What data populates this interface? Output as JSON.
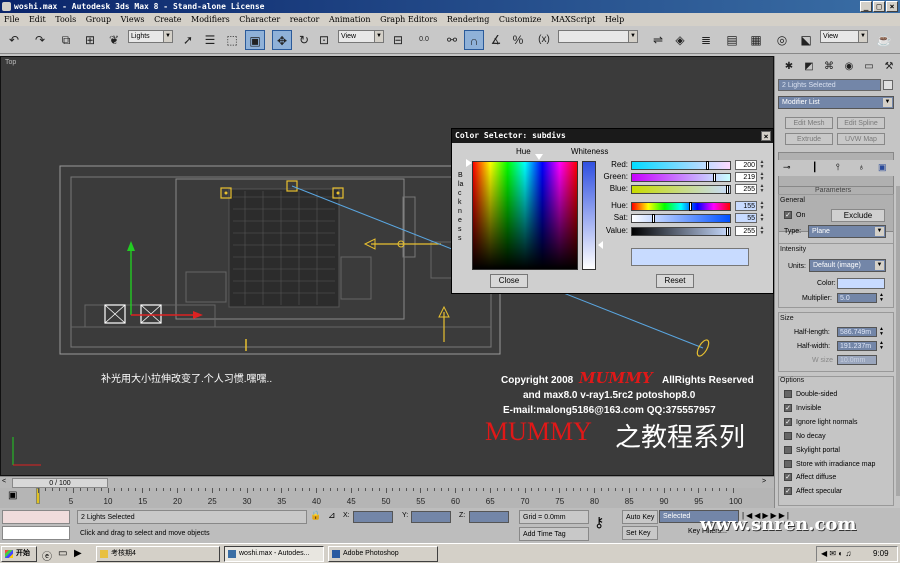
{
  "window": {
    "title": "woshi.max - Autodesk 3ds Max 8 - Stand-alone License",
    "buttons": [
      "_",
      "□",
      "×"
    ]
  },
  "menu": [
    "File",
    "Edit",
    "Tools",
    "Group",
    "Views",
    "Create",
    "Modifiers",
    "Character",
    "reactor",
    "Animation",
    "Graph Editors",
    "Rendering",
    "Customize",
    "MAXScript",
    "Help"
  ],
  "toolbar": {
    "selection_filter": "Lights",
    "ref_coord": "View",
    "named_selection": "",
    "view_dropdown": "View",
    "ang_snap": "0.0"
  },
  "viewport": {
    "label": "Top",
    "caption": "补光用大小拉伸改变了.个人习惯.嘿嘿..",
    "watermark": {
      "copyright_prefix": "Copyright 2008",
      "brand": "MUMMY",
      "rights": "AllRights Reserved",
      "software": "and max8.0 v-ray1.5rc2 potoshop8.0",
      "email": "E-mail:malong5186@163.com QQ:375557957",
      "series_brand": "MUMMY",
      "series_text": "之教程系列"
    }
  },
  "color_selector": {
    "title": "Color Selector: subdivs",
    "hue_label": "Hue",
    "whiteness_label": "Whiteness",
    "blackness_label": "Blackness",
    "channels": [
      {
        "label": "Red:",
        "value": "200",
        "level": 0.784
      },
      {
        "label": "Green:",
        "value": "219",
        "level": 0.859
      },
      {
        "label": "Blue:",
        "value": "255",
        "level": 1.0
      },
      {
        "label": "Hue:",
        "value": "155",
        "level": 0.608
      },
      {
        "label": "Sat:",
        "value": "55",
        "level": 0.216
      },
      {
        "label": "Value:",
        "value": "255",
        "level": 1.0
      }
    ],
    "close_label": "Close",
    "reset_label": "Reset",
    "swatch_color": "#c8dbff"
  },
  "command_panel": {
    "selection": "2 Lights Selected",
    "modifier_list": "Modifier List",
    "buttons": [
      "Edit Mesh",
      "Edit Spline",
      "Extrude",
      "UVW Map"
    ],
    "parameters_title": "Parameters",
    "general": {
      "title": "General",
      "on_label": "On",
      "on_checked": true,
      "exclude_label": "Exclude",
      "type_label": "Type:",
      "type_value": "Plane"
    },
    "intensity": {
      "title": "Intensity",
      "units_label": "Units:",
      "units_value": "Default (image)",
      "color_label": "Color:",
      "color_value": "#c8dbff",
      "multiplier_label": "Multiplier:",
      "multiplier_value": "5.0"
    },
    "size": {
      "title": "Size",
      "half_length_label": "Half-length:",
      "half_length_value": "586.749m",
      "half_width_label": "Half-width:",
      "half_width_value": "191.237m",
      "w_size_label": "W size",
      "w_size_value": "10.0mm"
    },
    "options": {
      "title": "Options",
      "items": [
        {
          "label": "Double-sided",
          "checked": false
        },
        {
          "label": "Invisible",
          "checked": true
        },
        {
          "label": "Ignore light normals",
          "checked": true
        },
        {
          "label": "No decay",
          "checked": false
        },
        {
          "label": "Skylight portal",
          "checked": false
        },
        {
          "label": "Store with irradiance map",
          "checked": false
        },
        {
          "label": "Affect diffuse",
          "checked": true
        },
        {
          "label": "Affect specular",
          "checked": true
        }
      ]
    }
  },
  "timeline": {
    "frame": "0 / 100",
    "ticks": [
      "0",
      "5",
      "10",
      "15",
      "20",
      "25",
      "30",
      "35",
      "40",
      "45",
      "50",
      "55",
      "60",
      "65",
      "70",
      "75",
      "80",
      "85",
      "90",
      "95",
      "100"
    ]
  },
  "status": {
    "selection": "2 Lights Selected",
    "prompt": "Click and drag to select and move objects",
    "x_label": "X:",
    "y_label": "Y:",
    "z_label": "Z:",
    "grid": "Grid = 0.0mm",
    "add_time_tag": "Add Time Tag",
    "auto_key": "Auto Key",
    "set_key": "Set Key",
    "key_filters": "Key Filters...",
    "key_mode": "Selected",
    "site": "www.snren.com"
  },
  "taskbar": {
    "start": "开始",
    "tasks": [
      "考核期4",
      "woshi.max - Autodes...",
      "Adobe Photoshop"
    ],
    "clock": "9:09"
  }
}
